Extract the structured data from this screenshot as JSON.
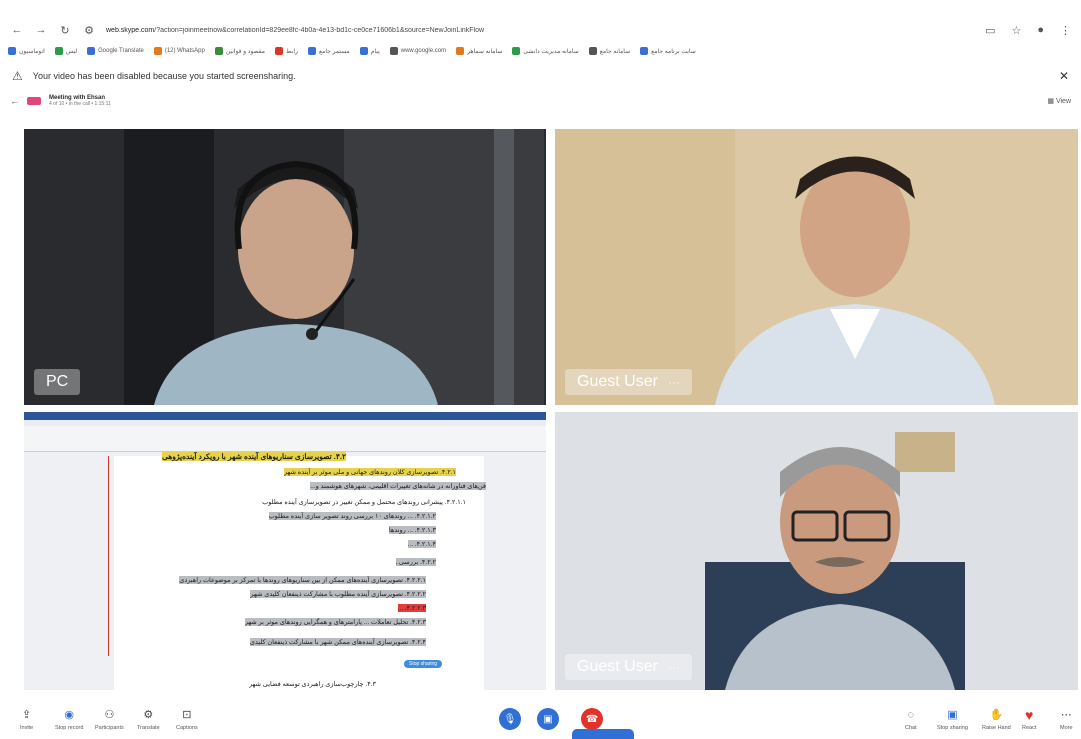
{
  "browser": {
    "url_host": "web.skype.com",
    "url_rest": "/?action=joinmeetnow&correlationId=829ee8fc-4b0a-4e13-bd1c-ce0ce71606b1&source=NewJoinLinkFlow",
    "bookmarks": [
      "اتوماسیون",
      "لیس",
      "Google Translate",
      "(12) WhatsApp",
      "مقصود و قوانین",
      "رابط",
      "مستمر جامع",
      "پیام",
      "www.google.com",
      "سامانه سماهر",
      "سامانه مدیریت دانشی",
      "سامانه جامع",
      "سایت برنامه جامع"
    ]
  },
  "notice": {
    "text": "Your video has been disabled because you started screensharing."
  },
  "meeting": {
    "title": "Meeting with Ehsan",
    "subtitle": "4 of 10 • in the call • 1:15:11",
    "view_label": "View"
  },
  "participants": [
    {
      "name": "PC"
    },
    {
      "name": "Guest User"
    },
    {
      "name": "Guest User"
    }
  ],
  "document": {
    "heading": "۴.۲. تصویرسازی سناریوهای آینده شهر با رویکرد آینده‌پژوهی",
    "lines": [
      "۴.۲.۱. تصویرسازی کلان روندهای جهانی و ملی موثر بر آینده شهر",
      "فن‌های فناورانه در شانه‌های تغییرات اقلیمی، شهرهای هوشمند و...",
      "۴.۲.۱.۱. پیشرانی روندهای محتمل و ممکن تغییر در تصویرسازی آینده مطلوب",
      "۴.۲.۱.۲. ... روندهای ۱۰ بررسی روند تصویر سازی آینده مطلوب",
      "۴.۲.۱.۳. ... روندها",
      "۴.۲.۱.۴. ...",
      "۴.۲.۲. بررسی و تعیین پراکنش و همگرایی روندهای موثر بر آینده توسعه شهر",
      "۴.۲.۲.۱. تصویرسازی آینده‌های ممکن از بین سناریوهای روندها با تمرکز بر موضوعات راهبردی",
      "۴.۲.۲.۲. تصویرسازی آینده مطلوب با مشارکت ذینفعان کلیدی شهر",
      "۴.۲.۲.۳. ...",
      "۴.۲.۳. تحلیل تعاملات ... پارامترهای و همگرایی روندهای موثر بر شهر",
      "۴.۲.۴. تصویرسازی آینده‌های ممکن شهر با مشارکت ذینفعان کلیدی",
      "۴.۳. چارچوب‌سازی راهبردی توسعه فضایی شهر"
    ],
    "button_label": "Stop sharing"
  },
  "toolbar": {
    "left": [
      {
        "icon": "invite-icon",
        "label": "Invite"
      },
      {
        "icon": "record-icon",
        "label": "Stop record"
      },
      {
        "icon": "participants-icon",
        "label": "Participants"
      },
      {
        "icon": "translate-icon",
        "label": "Translate"
      },
      {
        "icon": "captions-icon",
        "label": "Captions"
      }
    ],
    "right": [
      {
        "icon": "chat-icon",
        "label": "Chat"
      },
      {
        "icon": "share-icon",
        "label": "Stop sharing"
      },
      {
        "icon": "raise-hand-icon",
        "label": "Raise Hand"
      },
      {
        "icon": "react-icon",
        "label": "React"
      },
      {
        "icon": "more-icon",
        "label": "More"
      }
    ]
  },
  "colors": {
    "mic": "#2f6fd6",
    "video": "#2f6fd6",
    "hangup": "#e0342b",
    "react_heart": "#e0342b",
    "highlight_yellow": "#e6d34a",
    "highlight_red": "#e23c3c",
    "highlight_gray": "#b9bcc1"
  }
}
